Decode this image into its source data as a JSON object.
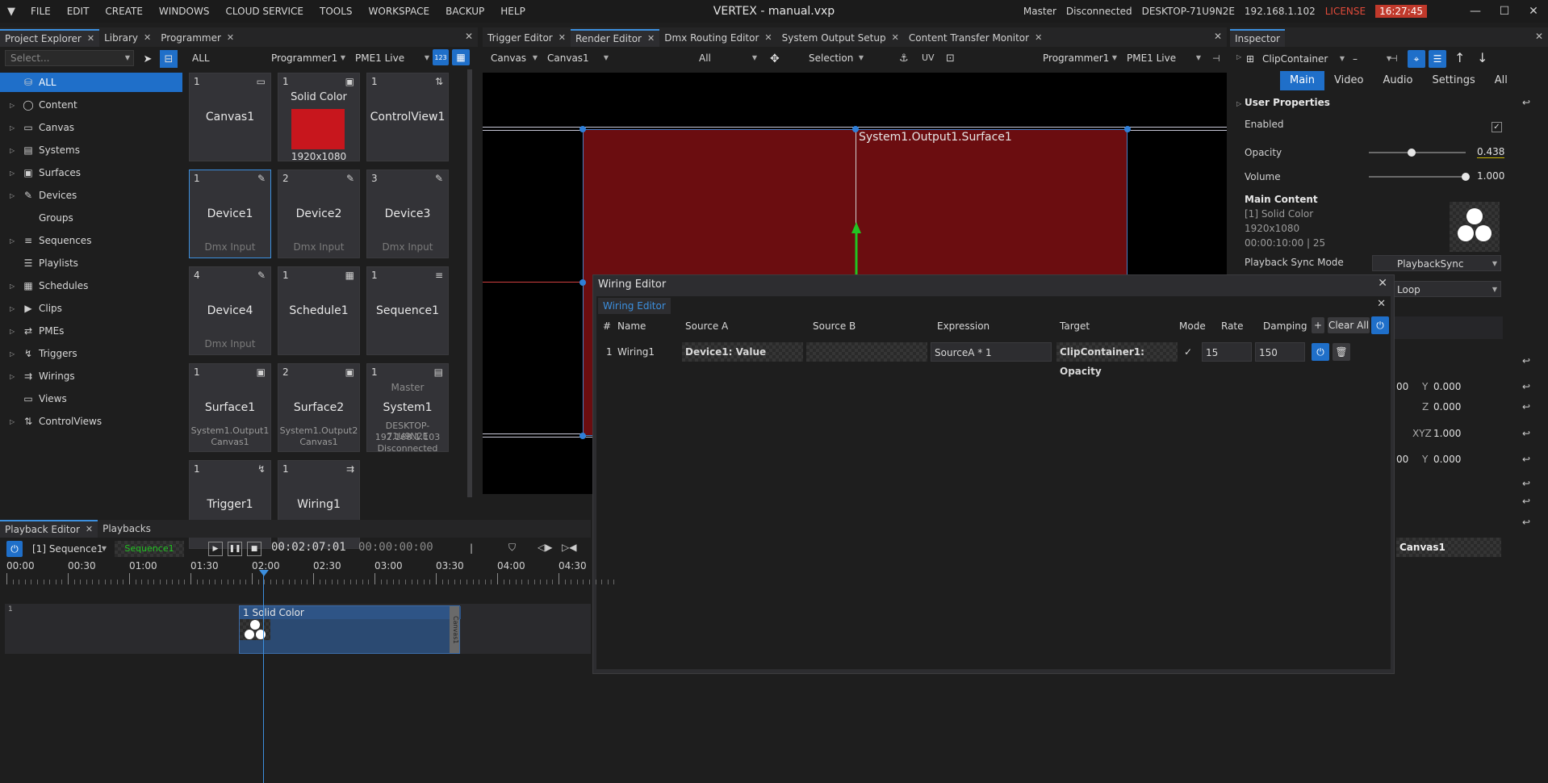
{
  "menu": {
    "logo": "▼",
    "items": [
      "FILE",
      "EDIT",
      "CREATE",
      "WINDOWS",
      "CLOUD SERVICE",
      "TOOLS",
      "WORKSPACE",
      "BACKUP",
      "HELP"
    ]
  },
  "title": "VERTEX - manual.vxp",
  "status": {
    "mode": "Master",
    "connection": "Disconnected",
    "host": "DESKTOP-71U9N2E",
    "ip": "192.168.1.102",
    "license": "LICENSE",
    "time": "16:27:45"
  },
  "left_tabs": [
    "Project Explorer",
    "Library",
    "Programmer"
  ],
  "explorer": {
    "search_placeholder": "Select...",
    "items": [
      {
        "label": "ALL",
        "icon": "⛁",
        "selected": true,
        "arrow": ""
      },
      {
        "label": "Content",
        "icon": "◯",
        "arrow": "▷"
      },
      {
        "label": "Canvas",
        "icon": "▭",
        "arrow": "▷"
      },
      {
        "label": "Systems",
        "icon": "▤",
        "arrow": "▷"
      },
      {
        "label": "Surfaces",
        "icon": "▣",
        "arrow": "▷"
      },
      {
        "label": "Devices",
        "icon": "✎",
        "arrow": "▷"
      },
      {
        "label": "Groups",
        "icon": "",
        "arrow": ""
      },
      {
        "label": "Sequences",
        "icon": "≡",
        "arrow": "▷"
      },
      {
        "label": "Playlists",
        "icon": "☰",
        "arrow": ""
      },
      {
        "label": "Schedules",
        "icon": "▦",
        "arrow": "▷"
      },
      {
        "label": "Clips",
        "icon": "▶",
        "arrow": "▷"
      },
      {
        "label": "PMEs",
        "icon": "⇄",
        "arrow": "▷"
      },
      {
        "label": "Triggers",
        "icon": "↯",
        "arrow": "▷"
      },
      {
        "label": "Wirings",
        "icon": "⇉",
        "arrow": "▷"
      },
      {
        "label": "Views",
        "icon": "▭",
        "arrow": ""
      },
      {
        "label": "ControlViews",
        "icon": "⇅",
        "arrow": "▷"
      }
    ]
  },
  "programmer": {
    "filter": "ALL",
    "programmer": "Programmer1",
    "pme": "PME1 Live",
    "view_btn": "123",
    "tiles": [
      {
        "n": "1",
        "name": "Canvas1",
        "icon": "▭",
        "sub": "",
        "l1": "",
        "l2": ""
      },
      {
        "n": "1",
        "name": "",
        "icon": "▣",
        "sub": "1920x1080",
        "l1": "",
        "l2": "",
        "top": "Solid Color",
        "swatch": "#c8161d"
      },
      {
        "n": "1",
        "name": "ControlView1",
        "icon": "⇅",
        "sub": "",
        "l1": "",
        "l2": ""
      },
      {
        "n": "1",
        "name": "Device1",
        "icon": "✎",
        "sub": "Dmx Input",
        "l1": "",
        "l2": "",
        "sel": true
      },
      {
        "n": "2",
        "name": "Device2",
        "icon": "✎",
        "sub": "Dmx Input",
        "l1": "",
        "l2": ""
      },
      {
        "n": "3",
        "name": "Device3",
        "icon": "✎",
        "sub": "Dmx Input",
        "l1": "",
        "l2": ""
      },
      {
        "n": "4",
        "name": "Device4",
        "icon": "✎",
        "sub": "Dmx Input",
        "l1": "",
        "l2": ""
      },
      {
        "n": "1",
        "name": "Schedule1",
        "icon": "▦",
        "sub": "",
        "l1": "",
        "l2": ""
      },
      {
        "n": "1",
        "name": "Sequence1",
        "icon": "≡",
        "sub": "",
        "l1": "",
        "l2": ""
      },
      {
        "n": "1",
        "name": "Surface1",
        "icon": "▣",
        "sub": "",
        "l1": "System1.Output1",
        "l2": "Canvas1"
      },
      {
        "n": "2",
        "name": "Surface2",
        "icon": "▣",
        "sub": "",
        "l1": "System1.Output2",
        "l2": "Canvas1"
      },
      {
        "n": "1",
        "name": "System1",
        "icon": "▤",
        "sub": "",
        "l1": "DESKTOP-71U9N2E",
        "l2": "192.168.1.103",
        "l3": "Disconnected",
        "top": "Master"
      },
      {
        "n": "1",
        "name": "Trigger1",
        "icon": "↯",
        "sub": "",
        "l1": "",
        "l2": ""
      },
      {
        "n": "1",
        "name": "Wiring1",
        "icon": "⇉",
        "sub": "",
        "l1": "",
        "l2": ""
      }
    ]
  },
  "center_tabs": [
    "Trigger Editor",
    "Render Editor",
    "Dmx Routing Editor",
    "System Output Setup",
    "Content Transfer Monitor"
  ],
  "render": {
    "canvas": "Canvas",
    "canvas_sel": "Canvas1",
    "filter": "All",
    "mode": "Selection",
    "programmer": "Programmer1",
    "pme": "PME1 Live",
    "surface_label": "System1.Output1.Surface1"
  },
  "wiring": {
    "title": "Wiring Editor",
    "tab": "Wiring Editor",
    "headers": {
      "num": "#",
      "name": "Name",
      "srcA": "Source A",
      "srcB": "Source B",
      "expr": "Expression",
      "target": "Target",
      "mode": "Mode",
      "rate": "Rate",
      "damping": "Damping",
      "add": "+",
      "clear": "Clear All"
    },
    "rows": [
      {
        "num": "1",
        "name": "Wiring1",
        "srcA": "Device1: Value",
        "srcB": "",
        "expr": "SourceA * 1",
        "target": "ClipContainer1: Opacity",
        "mode": "✓",
        "rate": "15",
        "damping": "150"
      }
    ]
  },
  "inspector": {
    "title": "Inspector",
    "object": "ClipContainer",
    "dash": "–",
    "tabs": [
      "Main",
      "Video",
      "Audio",
      "Settings",
      "All"
    ],
    "section": "User Properties",
    "enabled_label": "Enabled",
    "enabled": "✓",
    "opacity_label": "Opacity",
    "opacity_value": "0.438",
    "opacity": 0.438,
    "volume_label": "Volume",
    "volume_value": "1.000",
    "volume": 1.0,
    "main_content": "Main Content",
    "mc1": "[1] Solid Color",
    "mc2": "1920x1080",
    "mc3": "00:00:10:00 | 25",
    "sync_label": "Playback Sync Mode",
    "sync_value": "PlaybackSync",
    "loop_value": "Loop",
    "y1_label": "Y",
    "y1": "0.000",
    "z_label": "Z",
    "z": "0.000",
    "xyz_label": "XYZ",
    "xyz": "1.000",
    "y2_label": "Y",
    "y2": "0.000",
    "x1": "00",
    "x2": "00",
    "canvas": "Canvas1"
  },
  "playback_tabs": [
    "Playback Editor",
    "Playbacks"
  ],
  "playback": {
    "sequence": "[1] Sequence1",
    "seq_badge": "Sequence1",
    "time1": "00:02:07:01",
    "time2": "00:00:00:00",
    "ruler": [
      "00:00",
      "00:30",
      "01:00",
      "01:30",
      "02:00",
      "02:30",
      "03:00",
      "03:30",
      "04:00",
      "04:30"
    ],
    "track_num": "1",
    "clip": "1 Solid Color",
    "clip_side": "Canvas1"
  }
}
